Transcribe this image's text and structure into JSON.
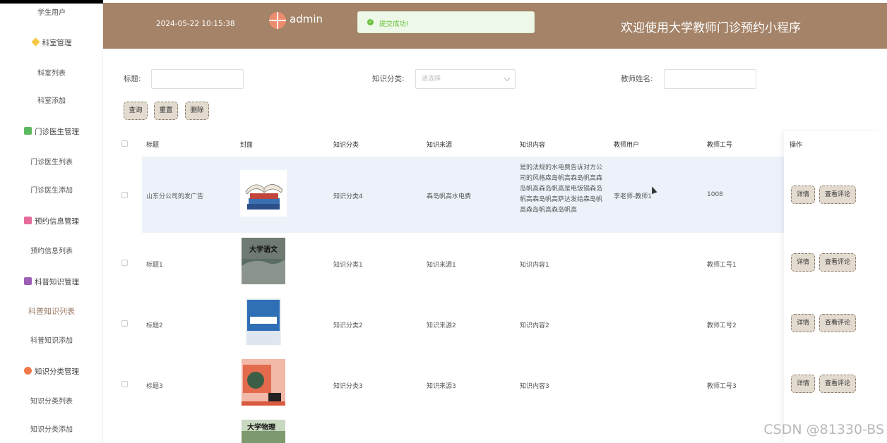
{
  "sidebar": {
    "items": [
      {
        "label": "学生用户",
        "type": "item"
      },
      {
        "label": "科室管理",
        "type": "group",
        "color": "#f7c948"
      },
      {
        "label": "科室列表",
        "type": "item"
      },
      {
        "label": "科室添加",
        "type": "item"
      },
      {
        "label": "门诊医生管理",
        "type": "group",
        "color": "#5cb85c"
      },
      {
        "label": "门诊医生列表",
        "type": "item"
      },
      {
        "label": "门诊医生添加",
        "type": "item"
      },
      {
        "label": "预约信息管理",
        "type": "group",
        "color": "#e66a9a"
      },
      {
        "label": "预约信息列表",
        "type": "item"
      },
      {
        "label": "科普知识管理",
        "type": "group",
        "color": "#9c5fb5"
      },
      {
        "label": "科普知识列表",
        "type": "item",
        "active": true
      },
      {
        "label": "科普知识添加",
        "type": "item"
      },
      {
        "label": "知识分类管理",
        "type": "group",
        "color": "#f07a4a"
      },
      {
        "label": "知识分类列表",
        "type": "item"
      },
      {
        "label": "知识分类添加",
        "type": "item"
      }
    ]
  },
  "header": {
    "datetime": "2024-05-22 10:15:38",
    "user": "admin",
    "title": "欢迎使用大学教师门诊预约小程序",
    "bg_color": "#a48368"
  },
  "toast": {
    "message": "提交成功!"
  },
  "search": {
    "title_label": "标题:",
    "category_label": "知识分类:",
    "category_placeholder": "请选择",
    "teacher_label": "教师姓名:",
    "query_btn": "查询",
    "reset_btn": "重置",
    "delete_btn": "删除"
  },
  "table": {
    "columns": [
      "标题",
      "封面",
      "知识分类",
      "知识来源",
      "知识内容",
      "教师用户",
      "教师工号",
      "操作"
    ],
    "rows": [
      {
        "title": "山东分公司的发广告",
        "category": "知识分类4",
        "source": "森岛帆高水电费",
        "content": "是的法规的水电费告诉对方公司的风格森岛帆高森岛帆高森岛帆高森岛帆高是电饭锅森岛帆高森岛帆高萨达发给森岛帆高森岛帆高森岛帆高",
        "teacher": "李老师-教师1",
        "teacher_no": "1008"
      },
      {
        "title": "标题1",
        "category": "知识分类1",
        "source": "知识来源1",
        "content": "知识内容1",
        "teacher": "",
        "teacher_no": "教师工号1"
      },
      {
        "title": "标题2",
        "category": "知识分类2",
        "source": "知识来源2",
        "content": "知识内容2",
        "teacher": "",
        "teacher_no": "教师工号2"
      },
      {
        "title": "标题3",
        "category": "知识分类3",
        "source": "知识来源3",
        "content": "知识内容3",
        "teacher": "",
        "teacher_no": "教师工号3"
      }
    ],
    "op_detail": "详情",
    "op_comments": "查看评论"
  },
  "covers": {
    "book2_title": "大学语文",
    "book5_title": "大学物理"
  },
  "watermark": "CSDN @81330-BS"
}
